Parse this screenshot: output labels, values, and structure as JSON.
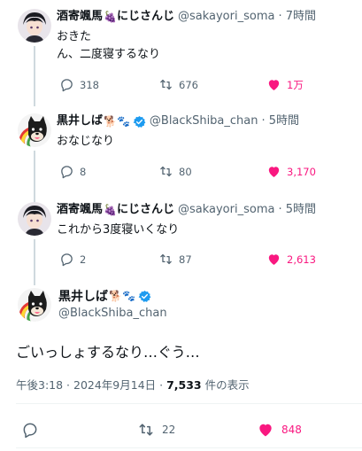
{
  "colors": {
    "like": "#f91880",
    "muted": "#536471",
    "thread_line": "#cfd9de",
    "verified": "#1d9bf0"
  },
  "tweets": [
    {
      "display_name": "酒寄颯馬",
      "name_emoji": "🍇",
      "affiliation": "にじさんじ",
      "handle": "@sakayori_soma",
      "time": "· 7時間",
      "text": "おきた\nん、二度寝するなり",
      "replies": "318",
      "retweets": "676",
      "likes": "1万"
    },
    {
      "display_name": "黒井しば",
      "name_emoji": "🐕🐾",
      "verified": true,
      "handle": "@BlackShiba_chan",
      "time": "· 5時間",
      "text": "おなじなり",
      "replies": "8",
      "retweets": "80",
      "likes": "3,170"
    },
    {
      "display_name": "酒寄颯馬",
      "name_emoji": "🍇",
      "affiliation": "にじさんじ",
      "handle": "@sakayori_soma",
      "time": "· 5時間",
      "text": "これから3度寝いくなり",
      "replies": "2",
      "retweets": "87",
      "likes": "2,613"
    }
  ],
  "focus": {
    "display_name": "黒井しば",
    "name_emoji": "🐕🐾",
    "verified": true,
    "handle": "@BlackShiba_chan",
    "text": "ごいっしょするなり…ぐう…",
    "timestamp": "午後3:18 · 2024年9月14日 · ",
    "views": "7,533",
    "views_suffix": " 件の表示",
    "retweets": "22",
    "likes": "848"
  }
}
